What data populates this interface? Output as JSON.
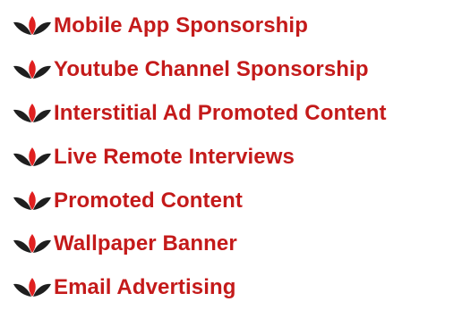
{
  "colors": {
    "link": "#c41a1a",
    "icon_leaves": "#1f1f1f",
    "icon_center": "#e02020"
  },
  "icon": "leaf-bullet-icon",
  "items": [
    {
      "label": "Mobile App Sponsorship"
    },
    {
      "label": "Youtube Channel Sponsorship"
    },
    {
      "label": "Interstitial Ad Promoted Content"
    },
    {
      "label": "Live Remote Interviews"
    },
    {
      "label": "Promoted Content"
    },
    {
      "label": "Wallpaper Banner"
    },
    {
      "label": "Email Advertising"
    }
  ]
}
